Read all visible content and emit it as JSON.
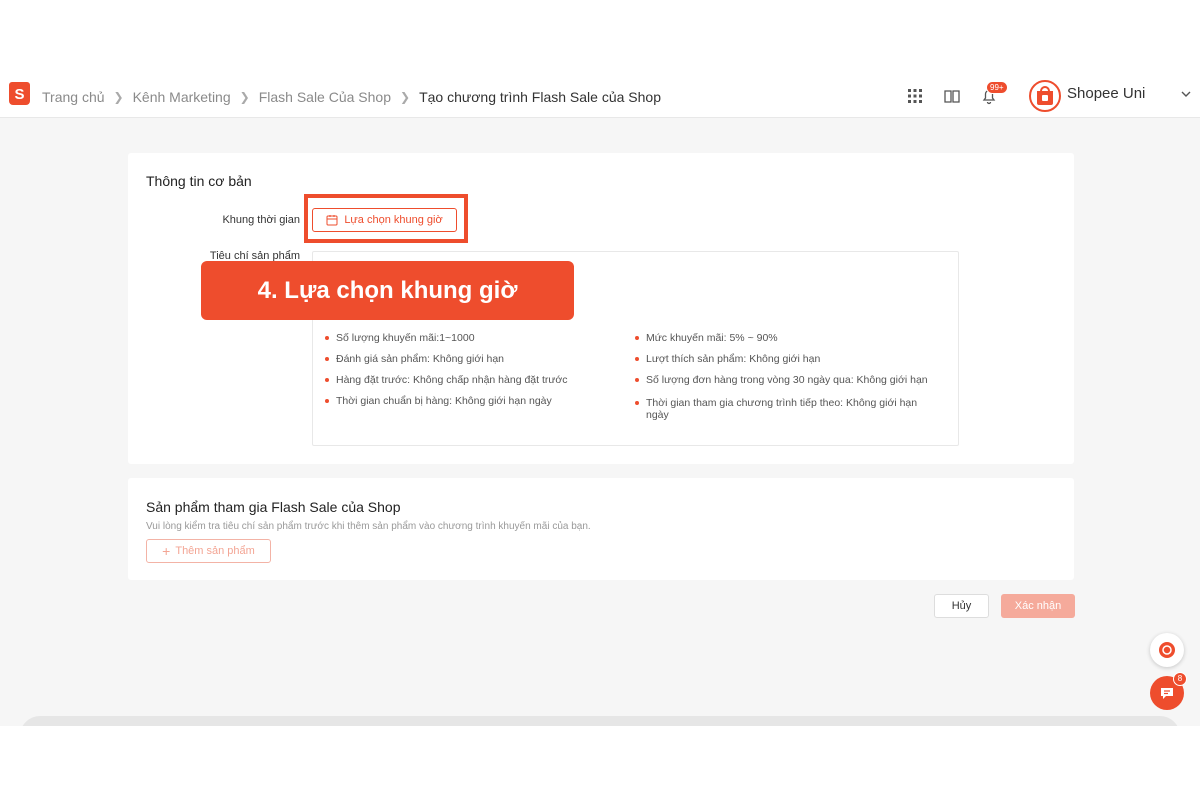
{
  "header": {
    "logo_letter": "S",
    "breadcrumbs": [
      "Trang chủ",
      "Kênh Marketing",
      "Flash Sale Của Shop",
      "Tạo chương trình Flash Sale của Shop"
    ],
    "notification_badge": "99+",
    "shop_name": "Shopee Uni",
    "icons": [
      "grid-icon",
      "book-icon",
      "bell-icon",
      "chevron-down-icon"
    ]
  },
  "basic_info": {
    "title": "Thông tin cơ bản",
    "time_label": "Khung thời gian",
    "select_slot_button": "Lựa chọn khung giờ",
    "criteria_label": "Tiêu chí sản phẩm",
    "criteria_left": [
      "Số lượng khuyến mãi:1~1000",
      "Đánh giá sản phẩm: Không giới hạn",
      "Hàng đặt trước: Không chấp nhận hàng đặt trước",
      "Thời gian chuẩn bị hàng: Không giới hạn ngày"
    ],
    "criteria_right": [
      "Mức khuyến mãi: 5% ~ 90%",
      "Lượt thích sản phẩm: Không giới hạn",
      "Số lượng đơn hàng trong vòng 30 ngày qua: Không giới hạn",
      "Thời gian tham gia chương trình tiếp theo: Không giới hạn ngày"
    ]
  },
  "banner": {
    "text": "4. Lựa chọn khung giờ"
  },
  "products": {
    "title": "Sản phẩm tham gia Flash Sale của Shop",
    "description": "Vui lòng kiểm tra tiêu chí sản phẩm trước khi thêm sản phẩm vào chương trình khuyến mãi của bạn.",
    "add_button": "Thêm sản phẩm"
  },
  "footer": {
    "cancel": "Hủy",
    "confirm": "Xác nhận"
  },
  "chat": {
    "badge": "8"
  },
  "colors": {
    "accent": "#ee4d2d",
    "accent_light": "#f5aa9b"
  }
}
